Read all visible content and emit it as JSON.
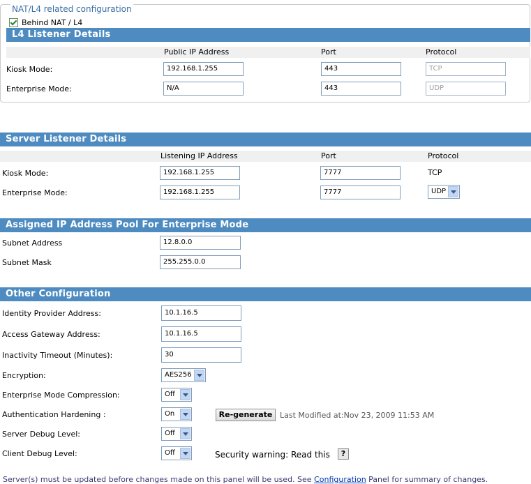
{
  "nat": {
    "legend": "NAT/L4 related configuration",
    "behind_label": "Behind NAT / L4",
    "behind_checked": true
  },
  "l4": {
    "title": "L4 Listener Details",
    "cols": [
      "Public IP Address",
      "Port",
      "Protocol"
    ],
    "kiosk": {
      "label": "Kiosk Mode:",
      "ip": "192.168.1.255",
      "port": "443",
      "protocol": "TCP"
    },
    "enterprise": {
      "label": "Enterprise Mode:",
      "ip": "N/A",
      "port": "443",
      "protocol": "UDP"
    }
  },
  "server": {
    "title": "Server Listener Details",
    "cols": [
      "Listening IP Address",
      "Port",
      "Protocol"
    ],
    "kiosk": {
      "label": "Kiosk Mode:",
      "ip": "192.168.1.255",
      "port": "7777",
      "protocol": "TCP"
    },
    "enterprise": {
      "label": "Enterprise Mode:",
      "ip": "192.168.1.255",
      "port": "7777",
      "protocol": "UDP"
    }
  },
  "pool": {
    "title": "Assigned IP Address Pool For Enterprise Mode",
    "subnet_label": "Subnet Address",
    "subnet_value": "12.8.0.0",
    "mask_label": "Subnet Mask",
    "mask_value": "255.255.0.0"
  },
  "other": {
    "title": "Other Configuration",
    "idp_label": "Identity Provider Address:",
    "idp_value": "10.1.16.5",
    "ag_label": "Access Gateway Address:",
    "ag_value": "10.1.16.5",
    "timeout_label": "Inactivity Timeout (Minutes):",
    "timeout_value": "30",
    "enc_label": "Encryption:",
    "enc_value": "AES256",
    "comp_label": "Enterprise Mode Compression:",
    "comp_value": "Off",
    "auth_label": "Authentication Hardening :",
    "auth_value": "On",
    "regen_label": "Re-generate",
    "last_modified": "Last Modified at:Nov 23, 2009 11:53 AM",
    "sdebug_label": "Server Debug Level:",
    "sdebug_value": "Off",
    "cdebug_label": "Client Debug Level:",
    "cdebug_value": "Off",
    "security_warning": "Security warning: Read this",
    "help_glyph": "?"
  },
  "footer": {
    "pre": "Server(s) must be updated before changes made on this panel will be used. See ",
    "link": "Configuration",
    "post": " Panel for summary of changes."
  }
}
